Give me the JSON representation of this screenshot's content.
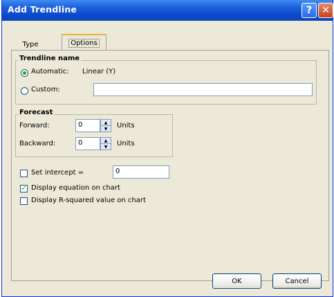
{
  "window": {
    "title": "Add Trendline"
  },
  "titlebar": {
    "help_glyph": "?",
    "close_glyph": "✕"
  },
  "tabs": [
    {
      "label": "Type"
    },
    {
      "label": "Options"
    }
  ],
  "trendline_name": {
    "group_label": "Trendline name",
    "automatic_label": "Automatic:",
    "automatic_value": "Linear (Y)",
    "custom_label": "Custom:",
    "custom_value": ""
  },
  "forecast": {
    "group_label": "Forecast",
    "forward_label": "Forward:",
    "forward_value": "0",
    "backward_label": "Backward:",
    "backward_value": "0",
    "units_label": "Units"
  },
  "options": {
    "set_intercept_label": "Set intercept =",
    "set_intercept_value": "0",
    "display_equation_label": "Display equation on chart",
    "display_rsquared_label": "Display R-squared value on chart"
  },
  "buttons": {
    "ok": "OK",
    "cancel": "Cancel"
  }
}
